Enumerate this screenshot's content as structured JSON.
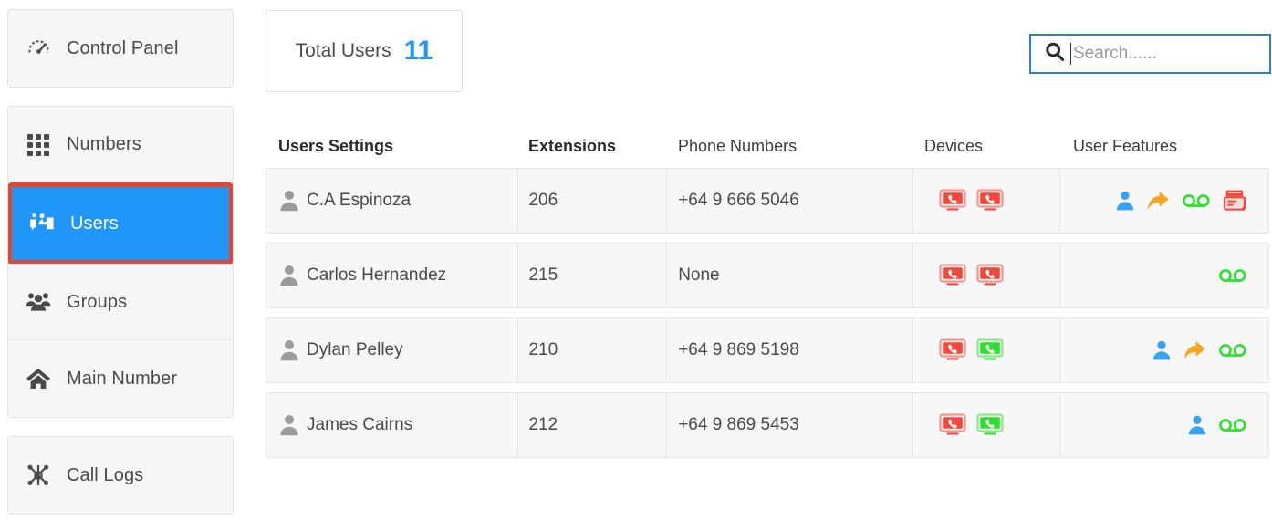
{
  "sidebar": {
    "groups": [
      {
        "items": [
          {
            "id": "control-panel",
            "label": "Control Panel",
            "icon": "dashboard-icon",
            "active": false
          }
        ]
      },
      {
        "items": [
          {
            "id": "numbers",
            "label": "Numbers",
            "icon": "grid-icon",
            "active": false
          },
          {
            "id": "users",
            "label": "Users",
            "icon": "users-icon",
            "active": true
          },
          {
            "id": "groups",
            "label": "Groups",
            "icon": "group-icon",
            "active": false
          },
          {
            "id": "main-number",
            "label": "Main Number",
            "icon": "home-icon",
            "active": false
          }
        ]
      },
      {
        "items": [
          {
            "id": "call-logs",
            "label": "Call Logs",
            "icon": "sitemap-icon",
            "active": false
          }
        ]
      }
    ],
    "active_item": "Users",
    "highlight_color": "#e2472f",
    "active_color": "#2196f9"
  },
  "summary": {
    "label": "Total Users",
    "value": "11",
    "value_color": "#2196f9"
  },
  "search": {
    "placeholder": "Search......",
    "value": "",
    "icon": "search-icon",
    "border_color": "#2a7fd4"
  },
  "table": {
    "columns": [
      {
        "key": "user",
        "label": "Users Settings",
        "bold": true
      },
      {
        "key": "ext",
        "label": "Extensions",
        "bold": true
      },
      {
        "key": "num",
        "label": "Phone Numbers",
        "bold": false
      },
      {
        "key": "dev",
        "label": "Devices",
        "bold": false
      },
      {
        "key": "feat",
        "label": "User Features",
        "bold": false
      }
    ],
    "rows": [
      {
        "name": "C.A Espinoza",
        "extension": "206",
        "phone": "+64 9 666 5046",
        "devices": [
          "desk-phone-red",
          "desk-phone-red"
        ],
        "features": [
          "user-blue",
          "call-forward-orange",
          "voicemail-green",
          "fax-red"
        ]
      },
      {
        "name": "Carlos Hernandez",
        "extension": "215",
        "phone": "None",
        "devices": [
          "desk-phone-red",
          "desk-phone-red"
        ],
        "features": [
          "voicemail-green"
        ]
      },
      {
        "name": "Dylan Pelley",
        "extension": "210",
        "phone": "+64 9 869 5198",
        "devices": [
          "desk-phone-red",
          "desk-phone-green"
        ],
        "features": [
          "user-blue",
          "call-forward-orange",
          "voicemail-green"
        ]
      },
      {
        "name": "James Cairns",
        "extension": "212",
        "phone": "+64 9 869 5453",
        "devices": [
          "desk-phone-red",
          "desk-phone-green"
        ],
        "features": [
          "user-blue",
          "voicemail-green"
        ]
      }
    ]
  },
  "colors": {
    "device_offline": "#f8463a",
    "device_online": "#2ee02e",
    "feature_user": "#38a3f5",
    "feature_forward": "#f5a623",
    "feature_voicemail": "#2ee02e",
    "feature_fax": "#f8463a",
    "row_bg": "#f7f7f7",
    "panel_bg": "#f6f6f6"
  }
}
